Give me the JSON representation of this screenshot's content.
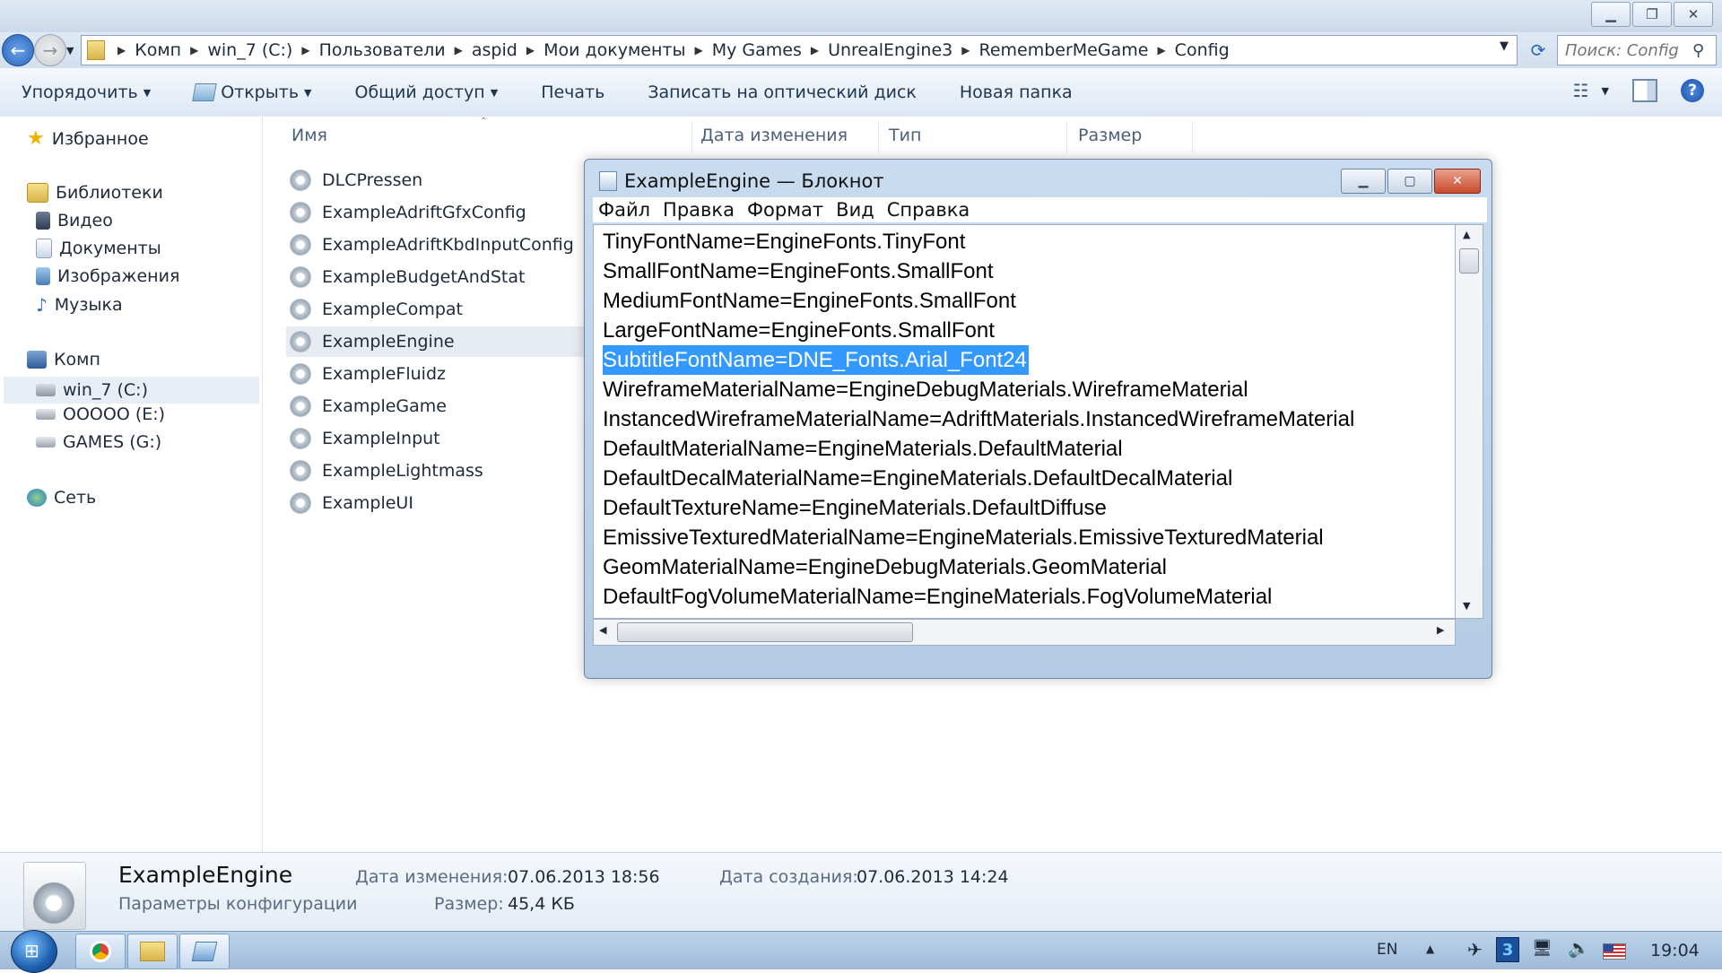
{
  "explorer": {
    "breadcrumb": [
      "Комп",
      "win_7 (C:)",
      "Пользователи",
      "aspid",
      "Мои документы",
      "My Games",
      "UnrealEngine3",
      "RememberMeGame",
      "Config"
    ],
    "search_placeholder": "Поиск: Config",
    "toolbar": {
      "organize": "Упорядочить",
      "open": "Открыть",
      "share": "Общий доступ",
      "print": "Печать",
      "burn": "Записать на оптический диск",
      "new_folder": "Новая папка"
    },
    "nav": {
      "favorites": "Избранное",
      "libraries": "Библиотеки",
      "video": "Видео",
      "documents": "Документы",
      "images": "Изображения",
      "music": "Музыка",
      "computer": "Комп",
      "drive_c": "win_7 (C:)",
      "drive_e": "OOOOO (E:)",
      "drive_g": "GAMES (G:)",
      "network": "Сеть"
    },
    "columns": {
      "name": "Имя",
      "modified": "Дата изменения",
      "type": "Тип",
      "size": "Размер"
    },
    "files": [
      "DLCPressen",
      "ExampleAdriftGfxConfig",
      "ExampleAdriftKbdInputConfig",
      "ExampleBudgetAndStat",
      "ExampleCompat",
      "ExampleEngine",
      "ExampleFluidz",
      "ExampleGame",
      "ExampleInput",
      "ExampleLightmass",
      "ExampleUI"
    ],
    "selected_file": "ExampleEngine",
    "details": {
      "name": "ExampleEngine",
      "type": "Параметры конфигурации",
      "modified_label": "Дата изменения:",
      "modified_value": "07.06.2013 18:56",
      "created_label": "Дата создания:",
      "created_value": "07.06.2013 14:24",
      "size_label": "Размер:",
      "size_value": "45,4 КБ"
    }
  },
  "notepad": {
    "title": "ExampleEngine — Блокнот",
    "menu": [
      "Файл",
      "Правка",
      "Формат",
      "Вид",
      "Справка"
    ],
    "lines": [
      "TinyFontName=EngineFonts.TinyFont",
      "SmallFontName=EngineFonts.SmallFont",
      "MediumFontName=EngineFonts.SmallFont",
      "LargeFontName=EngineFonts.SmallFont",
      "SubtitleFontName=DNE_Fonts.Arial_Font24",
      "WireframeMaterialName=EngineDebugMaterials.WireframeMaterial",
      "InstancedWireframeMaterialName=AdriftMaterials.InstancedWireframeMaterial",
      "DefaultMaterialName=EngineMaterials.DefaultMaterial",
      "DefaultDecalMaterialName=EngineMaterials.DefaultDecalMaterial",
      "DefaultTextureName=EngineMaterials.DefaultDiffuse",
      "EmissiveTexturedMaterialName=EngineMaterials.EmissiveTexturedMaterial",
      "GeomMaterialName=EngineDebugMaterials.GeomMaterial",
      "DefaultFogVolumeMaterialName=EngineMaterials.FogVolumeMaterial"
    ],
    "selected_line": "SubtitleFontName=DNE_Fonts.Arial_Font24"
  },
  "taskbar": {
    "language": "EN",
    "clock": "19:04",
    "tray_badge": "3"
  },
  "colors": {
    "selection": "#3399ff",
    "close_button": "#c84a2c",
    "taskbar": "#9fbad8"
  }
}
